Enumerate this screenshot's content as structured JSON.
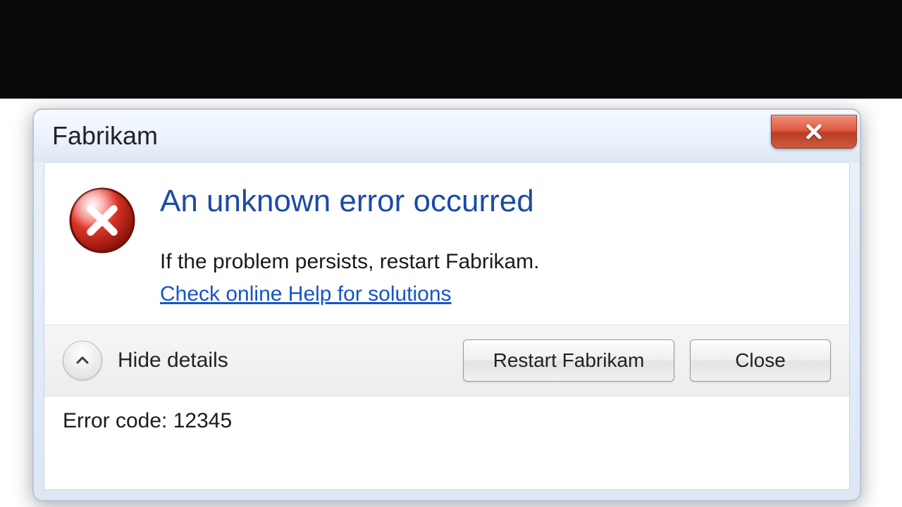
{
  "window": {
    "title": "Fabrikam"
  },
  "dialog": {
    "headline": "An unknown error occurred",
    "description": "If the problem persists, restart Fabrikam.",
    "help_link": "Check online Help for solutions",
    "toggle_label": "Hide details",
    "primary_button": "Restart Fabrikam",
    "secondary_button": "Close"
  },
  "details": {
    "error_code_label": "Error code:",
    "error_code_value": "12345"
  },
  "colors": {
    "headline": "#1b4aa8",
    "link": "#1555c9",
    "close_button": "#e05a3f"
  }
}
